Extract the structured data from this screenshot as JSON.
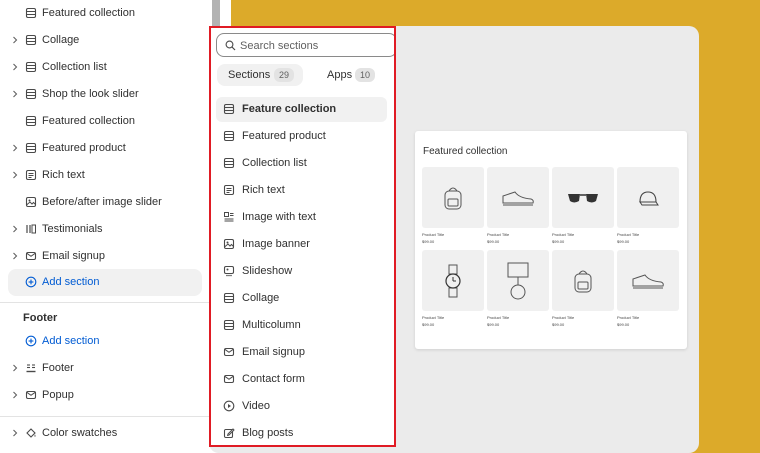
{
  "sidebar": {
    "items": [
      {
        "label": "Featured collection",
        "icon": "section-icon",
        "chevron": false
      },
      {
        "label": "Collage",
        "icon": "section-icon",
        "chevron": true
      },
      {
        "label": "Collection list",
        "icon": "section-icon",
        "chevron": true
      },
      {
        "label": "Shop the look slider",
        "icon": "section-icon",
        "chevron": true
      },
      {
        "label": "Featured collection",
        "icon": "section-icon",
        "chevron": false
      },
      {
        "label": "Featured product",
        "icon": "section-icon",
        "chevron": true
      },
      {
        "label": "Rich text",
        "icon": "text-block-icon",
        "chevron": true
      },
      {
        "label": "Before/after image slider",
        "icon": "image-compare-icon",
        "chevron": false
      },
      {
        "label": "Testimonials",
        "icon": "columns-icon",
        "chevron": true
      },
      {
        "label": "Email signup",
        "icon": "mail-icon",
        "chevron": true
      }
    ],
    "add_section_label": "Add section",
    "footer_group": {
      "title": "Footer",
      "add_section_label": "Add section",
      "items": [
        {
          "label": "Footer",
          "icon": "footer-icon"
        },
        {
          "label": "Popup",
          "icon": "mail-icon"
        }
      ]
    },
    "color_swatches_label": "Color swatches"
  },
  "picker": {
    "search_placeholder": "Search sections",
    "tabs": [
      {
        "label": "Sections",
        "count": "29"
      },
      {
        "label": "Apps",
        "count": "10"
      }
    ],
    "items": [
      {
        "label": "Feature collection",
        "icon": "section-icon",
        "active": true
      },
      {
        "label": "Featured product",
        "icon": "section-icon"
      },
      {
        "label": "Collection list",
        "icon": "section-icon"
      },
      {
        "label": "Rich text",
        "icon": "text-block-icon"
      },
      {
        "label": "Image with text",
        "icon": "image-with-text-icon"
      },
      {
        "label": "Image banner",
        "icon": "image-icon"
      },
      {
        "label": "Slideshow",
        "icon": "slideshow-icon"
      },
      {
        "label": "Collage",
        "icon": "section-icon"
      },
      {
        "label": "Multicolumn",
        "icon": "section-icon"
      },
      {
        "label": "Email signup",
        "icon": "mail-icon"
      },
      {
        "label": "Contact form",
        "icon": "mail-icon"
      },
      {
        "label": "Video",
        "icon": "play-icon"
      },
      {
        "label": "Blog posts",
        "icon": "edit-icon"
      }
    ]
  },
  "preview": {
    "title": "Featured collection",
    "products": [
      {
        "title": "Product Title",
        "price": "$99.00",
        "icon": "backpack-icon"
      },
      {
        "title": "Product Title",
        "price": "$99.00",
        "icon": "sneaker-icon"
      },
      {
        "title": "Product Title",
        "price": "$99.00",
        "icon": "sunglasses-icon"
      },
      {
        "title": "Product Title",
        "price": "$99.00",
        "icon": "cap-icon"
      },
      {
        "title": "Product Title",
        "price": "$99.00",
        "icon": "watch-icon"
      },
      {
        "title": "Product Title",
        "price": "$99.00",
        "icon": "lamp-icon"
      },
      {
        "title": "Product Title",
        "price": "$99.00",
        "icon": "backpack-icon"
      },
      {
        "title": "Product Title",
        "price": "$99.00",
        "icon": "sneaker-icon"
      }
    ]
  },
  "colors": {
    "canvas_background": "#dcaa2a",
    "highlight_border": "#e01b24",
    "link_blue": "#005bd3"
  }
}
